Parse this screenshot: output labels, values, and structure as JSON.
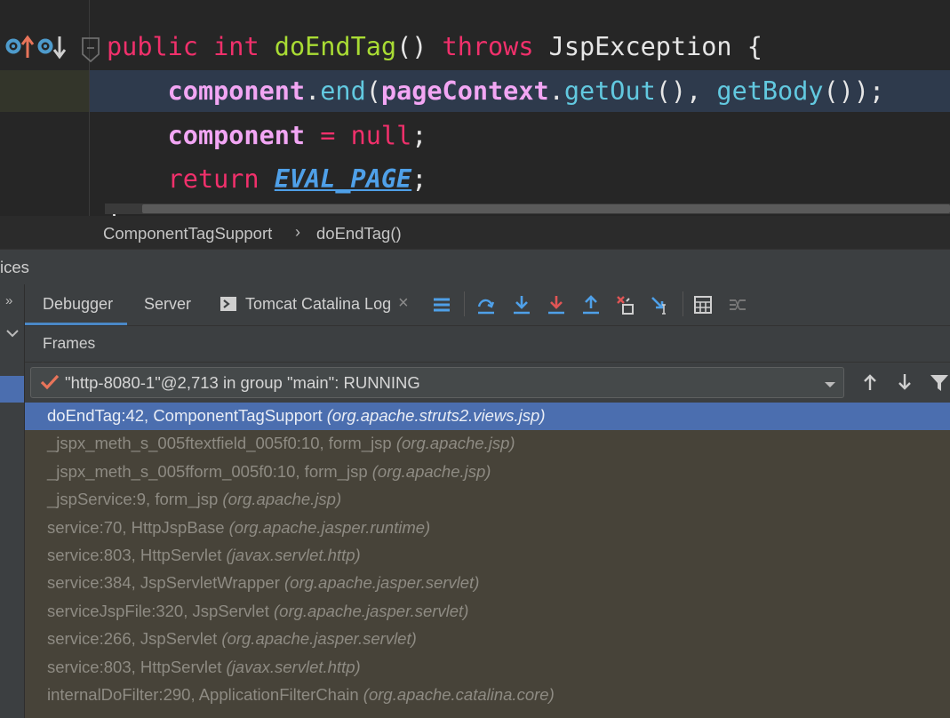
{
  "editor": {
    "lines": [
      {
        "tokens": [
          {
            "t": "public",
            "c": "kw"
          },
          {
            "t": " ",
            "c": "plain"
          },
          {
            "t": "int",
            "c": "kw"
          },
          {
            "t": " ",
            "c": "plain"
          },
          {
            "t": "doEndTag",
            "c": "fn"
          },
          {
            "t": "() ",
            "c": "plain"
          },
          {
            "t": "throws",
            "c": "kw"
          },
          {
            "t": " JspException {",
            "c": "plain"
          }
        ]
      },
      {
        "tokens": [
          {
            "t": "    ",
            "c": "plain"
          },
          {
            "t": "component",
            "c": "fld"
          },
          {
            "t": ".",
            "c": "plain"
          },
          {
            "t": "end",
            "c": "mcall"
          },
          {
            "t": "(",
            "c": "plain"
          },
          {
            "t": "pageContext",
            "c": "fld"
          },
          {
            "t": ".",
            "c": "plain"
          },
          {
            "t": "getOut",
            "c": "mcall"
          },
          {
            "t": "(), ",
            "c": "plain"
          },
          {
            "t": "getBody",
            "c": "mcall"
          },
          {
            "t": "());",
            "c": "plain"
          }
        ]
      },
      {
        "tokens": [
          {
            "t": "    ",
            "c": "plain"
          },
          {
            "t": "component",
            "c": "fld"
          },
          {
            "t": " ",
            "c": "plain"
          },
          {
            "t": "=",
            "c": "kw"
          },
          {
            "t": " ",
            "c": "plain"
          },
          {
            "t": "null",
            "c": "kw"
          },
          {
            "t": ";",
            "c": "plain"
          }
        ]
      },
      {
        "tokens": [
          {
            "t": "    ",
            "c": "plain"
          },
          {
            "t": "return",
            "c": "kw"
          },
          {
            "t": " ",
            "c": "plain"
          },
          {
            "t": "EVAL_PAGE",
            "c": "const"
          },
          {
            "t": ";",
            "c": "plain"
          }
        ]
      }
    ],
    "partial_line": "}"
  },
  "breadcrumb": {
    "items": [
      "ComponentTagSupport",
      "doEndTag()"
    ]
  },
  "services": {
    "title_fragment": "ices"
  },
  "debugger": {
    "tabs": [
      {
        "label": "Debugger"
      },
      {
        "label": "Server"
      },
      {
        "label": "Tomcat Catalina Log"
      }
    ],
    "frames_label": "Frames",
    "thread": "\"http-8080-1\"@2,713 in group \"main\": RUNNING",
    "frames": [
      {
        "method": "doEndTag:42, ComponentTagSupport ",
        "pkg": "(org.apache.struts2.views.jsp)",
        "selected": true
      },
      {
        "method": "_jspx_meth_s_005ftextfield_005f0:10, form_jsp ",
        "pkg": "(org.apache.jsp)"
      },
      {
        "method": "_jspx_meth_s_005fform_005f0:10, form_jsp ",
        "pkg": "(org.apache.jsp)"
      },
      {
        "method": "_jspService:9, form_jsp ",
        "pkg": "(org.apache.jsp)"
      },
      {
        "method": "service:70, HttpJspBase ",
        "pkg": "(org.apache.jasper.runtime)"
      },
      {
        "method": "service:803, HttpServlet ",
        "pkg": "(javax.servlet.http)"
      },
      {
        "method": "service:384, JspServletWrapper ",
        "pkg": "(org.apache.jasper.servlet)"
      },
      {
        "method": "serviceJspFile:320, JspServlet ",
        "pkg": "(org.apache.jasper.servlet)"
      },
      {
        "method": "service:266, JspServlet ",
        "pkg": "(org.apache.jasper.servlet)"
      },
      {
        "method": "service:803, HttpServlet ",
        "pkg": "(javax.servlet.http)"
      },
      {
        "method": "internalDoFilter:290, ApplicationFilterChain ",
        "pkg": "(org.apache.catalina.core)"
      }
    ]
  },
  "colors": {
    "keyword": "#f0306b",
    "function": "#a9dc34",
    "field": "#f2a6f4",
    "method_call": "#62c9e0",
    "constant": "#4fa0e8",
    "selection": "#4b6eaf",
    "frames_bg": "#474339"
  },
  "icons": {
    "gutter": [
      "implements-up-icon",
      "overridden-down-icon"
    ],
    "toolbar": [
      "threads-icon",
      "step-over-icon",
      "step-into-icon",
      "force-step-into-icon",
      "step-out-icon",
      "drop-frame-icon",
      "run-to-cursor-icon",
      "evaluate-expression-icon",
      "trace-stream-icon"
    ],
    "thread_status": "check-icon",
    "navigation": [
      "arrow-up-icon",
      "arrow-down-icon",
      "filter-icon"
    ]
  }
}
